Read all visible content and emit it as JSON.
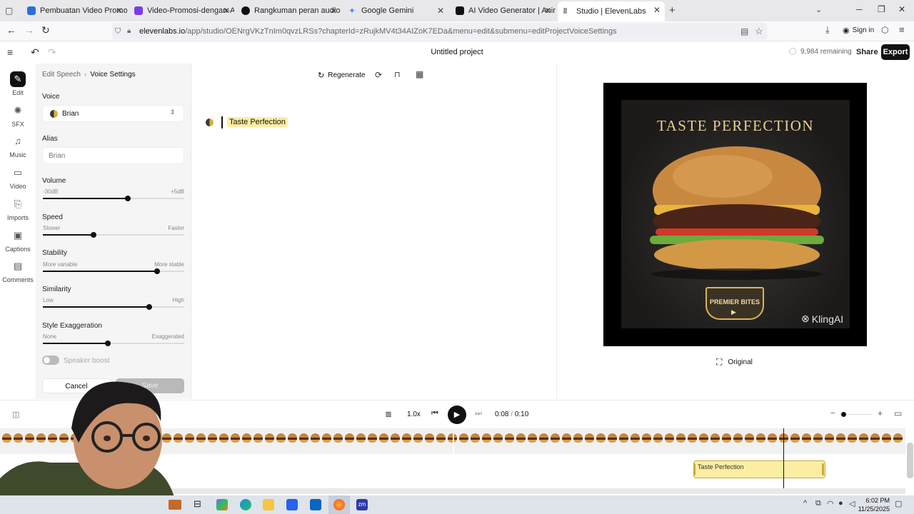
{
  "browser": {
    "tabs": [
      {
        "title": "Pembuatan Video Promosi Den",
        "color": "#2d6cdf"
      },
      {
        "title": "Video-Promosi-dengan-AI.pptx",
        "color": "#7c3aed"
      },
      {
        "title": "Rangkuman peran audio",
        "color": "#111111"
      },
      {
        "title": "Google Gemini",
        "color": "#4c8df6"
      },
      {
        "title": "AI Video Generator | Animate P",
        "color": "#111111"
      },
      {
        "title": "Studio | ElevenLabs",
        "color": "#111111"
      }
    ],
    "url_domain": "elevenlabs.io",
    "url_rest": "/app/studio/OENrgVKzTnIm0qvzLRSs?chapterId=zRujkMV4t34AIZoK7EDa&menu=edit&submenu=editProjectVoiceSettings",
    "sign_in": "Sign in"
  },
  "header": {
    "title": "Untitled project",
    "remaining": "9,984 remaining",
    "share": "Share",
    "export": "Export"
  },
  "rail": [
    {
      "label": "Edit",
      "icon": "edit-icon",
      "glyph": "✎"
    },
    {
      "label": "SFX",
      "icon": "sfx-icon",
      "glyph": "✺"
    },
    {
      "label": "Music",
      "icon": "music-icon",
      "glyph": "♫"
    },
    {
      "label": "Video",
      "icon": "video-icon",
      "glyph": "▭"
    },
    {
      "label": "Imports",
      "icon": "imports-icon",
      "glyph": "⎘"
    },
    {
      "label": "Captions",
      "icon": "captions-icon",
      "glyph": "▣"
    },
    {
      "label": "Comments",
      "icon": "comments-icon",
      "glyph": "▤"
    }
  ],
  "panel": {
    "breadcrumb_parent": "Edit Speech",
    "breadcrumb_current": "Voice Settings",
    "voice_label": "Voice",
    "voice_value": "Brian",
    "alias_label": "Alias",
    "alias_placeholder": "Brian",
    "volume": {
      "label": "Volume",
      "min": "-30dB",
      "max": "+5dB",
      "value": 0.6
    },
    "speed": {
      "label": "Speed",
      "min": "Slower",
      "max": "Faster",
      "value": 0.36
    },
    "stability": {
      "label": "Stability",
      "min": "More variable",
      "max": "More stable",
      "value": 0.81
    },
    "similarity": {
      "label": "Similarity",
      "min": "Low",
      "max": "High",
      "value": 0.75
    },
    "style": {
      "label": "Style Exaggeration",
      "min": "None",
      "max": "Exaggerated",
      "value": 0.46
    },
    "speaker_boost": "Speaker boost",
    "cancel": "Cancel",
    "save": "Save"
  },
  "editor": {
    "regenerate": "Regenerate",
    "text": "Taste Perfection"
  },
  "preview": {
    "headline": "TASTE PERFECTION",
    "brand": "PREMIER BITES",
    "watermark": "KlingAI",
    "original": "Original"
  },
  "timeline": {
    "speed": "1.0x",
    "time_current": "0:08",
    "time_total": "0:10",
    "clip_label": "Taste Perfection"
  },
  "taskbar": {
    "time": "6:02 PM",
    "date": "11/25/2025"
  }
}
